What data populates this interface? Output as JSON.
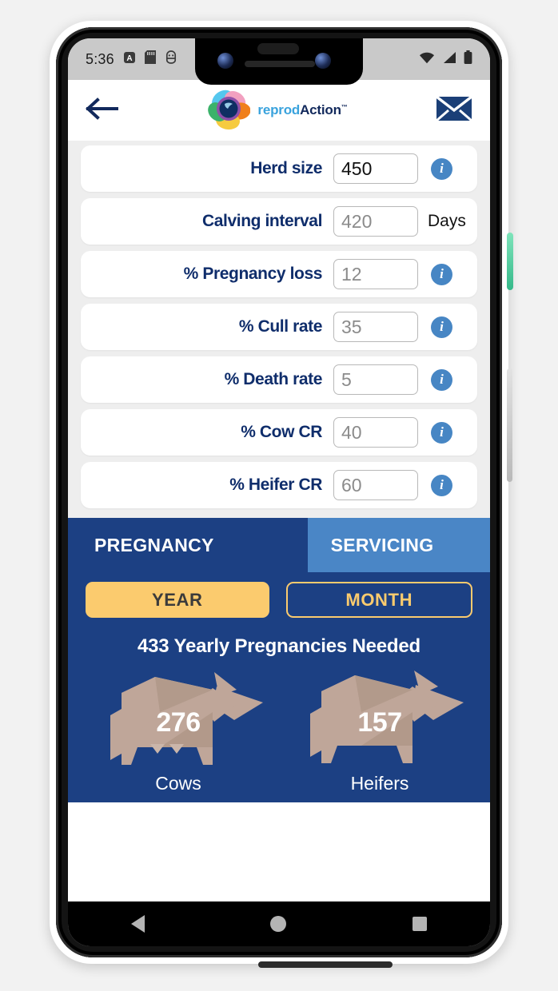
{
  "status_bar": {
    "time": "5:36",
    "icons": [
      "alarm-a-icon",
      "sd-card-icon",
      "android-debug-icon"
    ],
    "right_icons": [
      "wifi-icon",
      "signal-icon",
      "battery-icon"
    ]
  },
  "header": {
    "back_icon": "back-arrow-icon",
    "brand_part1": "reprod",
    "brand_part2": "Action",
    "brand_tm": "™",
    "mail_icon": "envelope-icon"
  },
  "form": {
    "fields": [
      {
        "label": "Herd size",
        "value": "450",
        "placeholder": "",
        "filled": true,
        "suffix": "",
        "has_info": true
      },
      {
        "label": "Calving interval",
        "value": "",
        "placeholder": "420",
        "filled": false,
        "suffix": "Days",
        "has_info": false
      },
      {
        "label": "% Pregnancy loss",
        "value": "",
        "placeholder": "12",
        "filled": false,
        "suffix": "",
        "has_info": true
      },
      {
        "label": "% Cull rate",
        "value": "",
        "placeholder": "35",
        "filled": false,
        "suffix": "",
        "has_info": true
      },
      {
        "label": "% Death rate",
        "value": "",
        "placeholder": "5",
        "filled": false,
        "suffix": "",
        "has_info": true
      },
      {
        "label": "% Cow CR",
        "value": "",
        "placeholder": "40",
        "filled": false,
        "suffix": "",
        "has_info": true
      },
      {
        "label": "% Heifer CR",
        "value": "",
        "placeholder": "60",
        "filled": false,
        "suffix": "",
        "has_info": true
      }
    ],
    "info_glyph": "i"
  },
  "results": {
    "tabs": [
      {
        "label": "PREGNANCY",
        "active": true
      },
      {
        "label": "SERVICING",
        "active": false
      }
    ],
    "periods": [
      {
        "label": "YEAR",
        "active": true
      },
      {
        "label": "MONTH",
        "active": false
      }
    ],
    "summary": "433 Yearly Pregnancies Needed",
    "animals": [
      {
        "count": "276",
        "label": "Cows"
      },
      {
        "count": "157",
        "label": "Heifers"
      }
    ]
  },
  "nav_bar": {
    "back": "nav-back-icon",
    "home": "nav-home-icon",
    "recents": "nav-recents-icon"
  },
  "colors": {
    "brand_navy": "#12295c",
    "panel_navy": "#1c4083",
    "tab_blue": "#4a86c6",
    "accent_amber": "#fbcb6e",
    "info_blue": "#4786c4",
    "animal_tan": "#bfa699"
  }
}
